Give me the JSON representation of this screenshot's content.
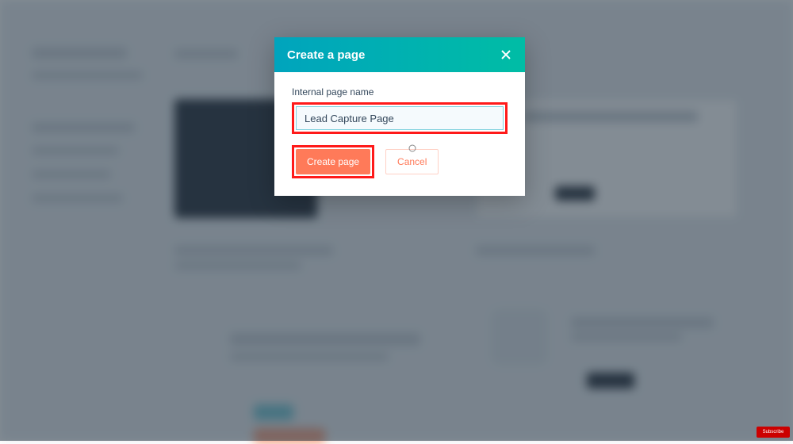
{
  "modal": {
    "title": "Create a page",
    "field_label": "Internal page name",
    "input_value": "Lead Capture Page",
    "create_label": "Create page",
    "cancel_label": "Cancel"
  },
  "badge": {
    "label": "Subscribe"
  }
}
